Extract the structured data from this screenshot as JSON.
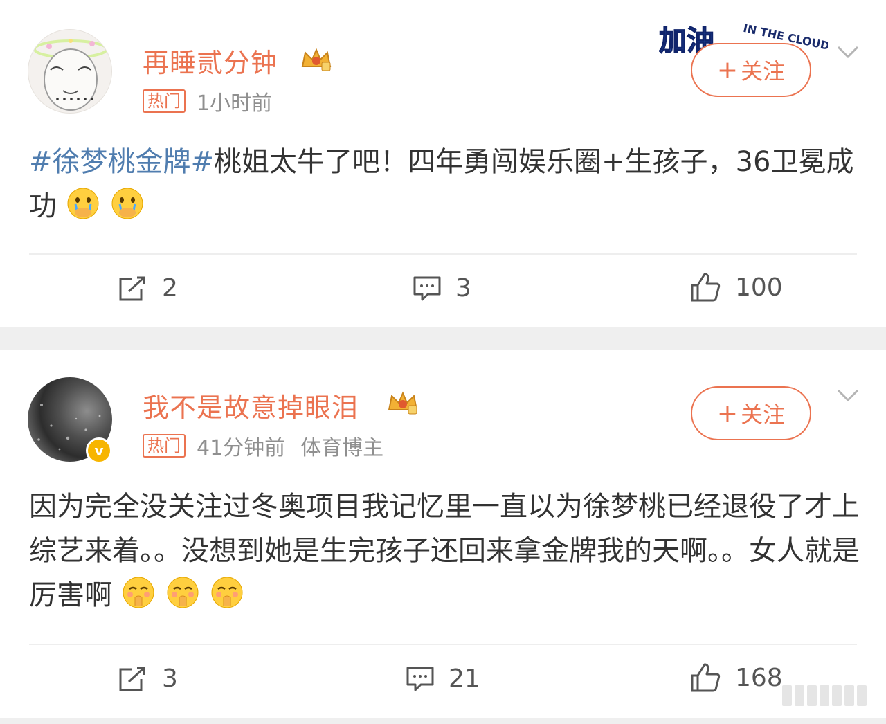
{
  "posts": [
    {
      "username": "再睡贰分钟",
      "hot_tag": "热门",
      "time": "1小时前",
      "follow_plus": "+",
      "follow_label": "关注",
      "hashtag": "#徐梦桃金牌#",
      "text": "桃姐太牛了吧！四年勇闯娱乐圈+生孩子，36卫冕成功",
      "emojis": [
        "crying-emoji",
        "crying-emoji"
      ],
      "reposts": "2",
      "comments": "3",
      "likes": "100"
    },
    {
      "username": "我不是故意掉眼泪",
      "verified_mark": "v",
      "hot_tag": "热门",
      "time": "41分钟前",
      "role": "体育博主",
      "follow_plus": "+",
      "follow_label": "关注",
      "text": "因为完全没关注过冬奥项目我记忆里一直以为徐梦桃已经退役了才上综艺来着。。没想到她是生完孩子还回来拿金牌我的天啊。。女人就是厉害啊",
      "emojis": [
        "shy-emoji",
        "shy-emoji",
        "shy-emoji"
      ],
      "reposts": "3",
      "comments": "21",
      "likes": "168"
    }
  ],
  "sticker": {
    "left_text": "加油",
    "right_text": "IN THE CLOUDS"
  },
  "colors": {
    "accent": "#eb7350",
    "hashtag": "#507daf",
    "text": "#333333",
    "meta": "#8f8f8f",
    "verified": "#f7b500"
  }
}
